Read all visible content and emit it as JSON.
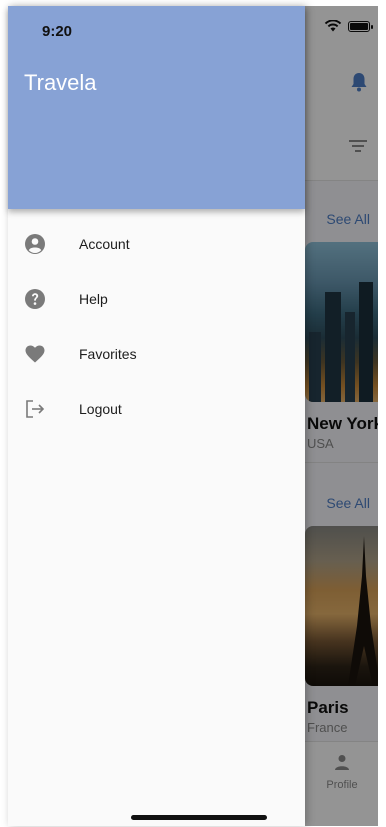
{
  "status_bar": {
    "time": "9:20"
  },
  "drawer": {
    "title": "Travela",
    "header_color": "#87a2d5",
    "menu": [
      {
        "label": "Account",
        "icon": "account-circle-icon"
      },
      {
        "label": "Help",
        "icon": "help-icon"
      },
      {
        "label": "Favorites",
        "icon": "heart-icon"
      },
      {
        "label": "Logout",
        "icon": "logout-icon"
      }
    ]
  },
  "background_screen": {
    "sections": [
      {
        "see_all_label": "See All",
        "destination": {
          "name": "New York",
          "country": "USA"
        }
      },
      {
        "see_all_label": "See All",
        "destination": {
          "name": "Paris",
          "country": "France"
        }
      }
    ],
    "bottom_nav": {
      "profile_label": "Profile"
    },
    "accent_color": "#4f7fc7"
  }
}
